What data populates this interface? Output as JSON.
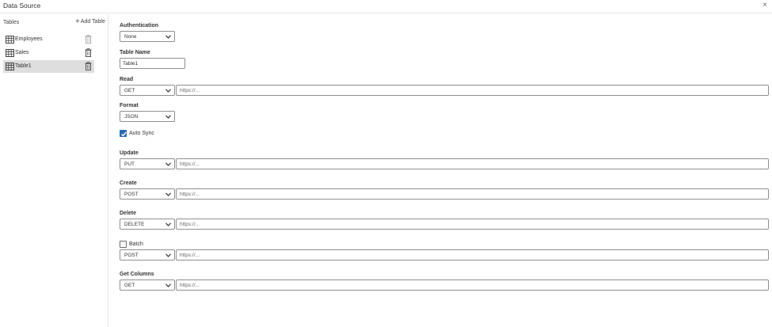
{
  "window": {
    "title": "Data Source",
    "close_glyph": "×"
  },
  "sidebar": {
    "title": "Tables",
    "add_label": "Add Table",
    "items": [
      {
        "label": "Employees",
        "icon": "table-icon",
        "delete_icon": "trash-icon",
        "selected": false
      },
      {
        "label": "Sales",
        "icon": "table-icon",
        "delete_icon": "trash-icon",
        "selected": false
      },
      {
        "label": "Table1",
        "icon": "table-icon",
        "delete_icon": "trash-icon",
        "selected": true
      }
    ]
  },
  "form": {
    "authentication": {
      "label": "Authentication",
      "value": "None"
    },
    "table_name": {
      "label": "Table Name",
      "value": "Table1"
    },
    "read": {
      "label": "Read",
      "method": "GET",
      "url_placeholder": "https://..."
    },
    "format": {
      "label": "Format",
      "value": "JSON"
    },
    "auto_sync": {
      "label": "Auto Sync",
      "checked": true
    },
    "update": {
      "label": "Update",
      "method": "PUT",
      "url_placeholder": "https://..."
    },
    "create": {
      "label": "Create",
      "method": "POST",
      "url_placeholder": "https://..."
    },
    "delete": {
      "label": "Delete",
      "method": "DELETE",
      "url_placeholder": "https://..."
    },
    "batch": {
      "label": "Batch",
      "checked": false,
      "method": "POST",
      "url_placeholder": "https://..."
    },
    "get_columns": {
      "label": "Get Columns",
      "method": "GET",
      "url_placeholder": "https://..."
    }
  },
  "colors": {
    "accent": "#2b6cb0",
    "selected_row": "#dedede",
    "border": "#8f8f8f",
    "divider": "#e3e3e3"
  }
}
